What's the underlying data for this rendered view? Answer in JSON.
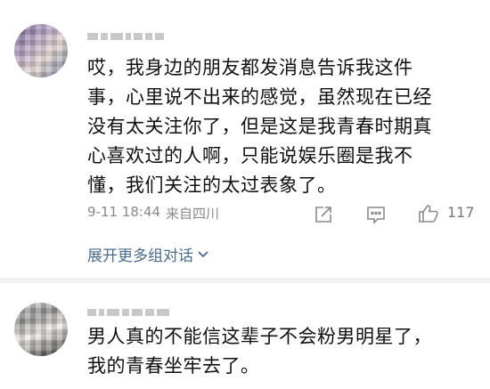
{
  "comments": [
    {
      "text": "哎，我身边的朋友都发消息告诉我这件\n事，心里说不出来的感觉，虽然现在已经\n没有太关注你了，但是这是我青春时期真\n心喜欢过的人啊，只能说娱乐圈是我不\n懂，我们关注的太过表象了。",
      "time": "9-11 18:44",
      "location": "来自四川",
      "like_count": "117",
      "expand_label": "展开更多组对话"
    },
    {
      "text": "男人真的不能信这辈子不会粉男明星了，\n我的青春坐牢去了。"
    }
  ],
  "icons": {
    "share": "share-icon",
    "comment": "comment-icon",
    "like": "like-icon",
    "chevron": "chevron-down-icon"
  },
  "colors": {
    "link": "#4a6b8f",
    "meta": "#8a8a8a",
    "text": "#111111"
  }
}
